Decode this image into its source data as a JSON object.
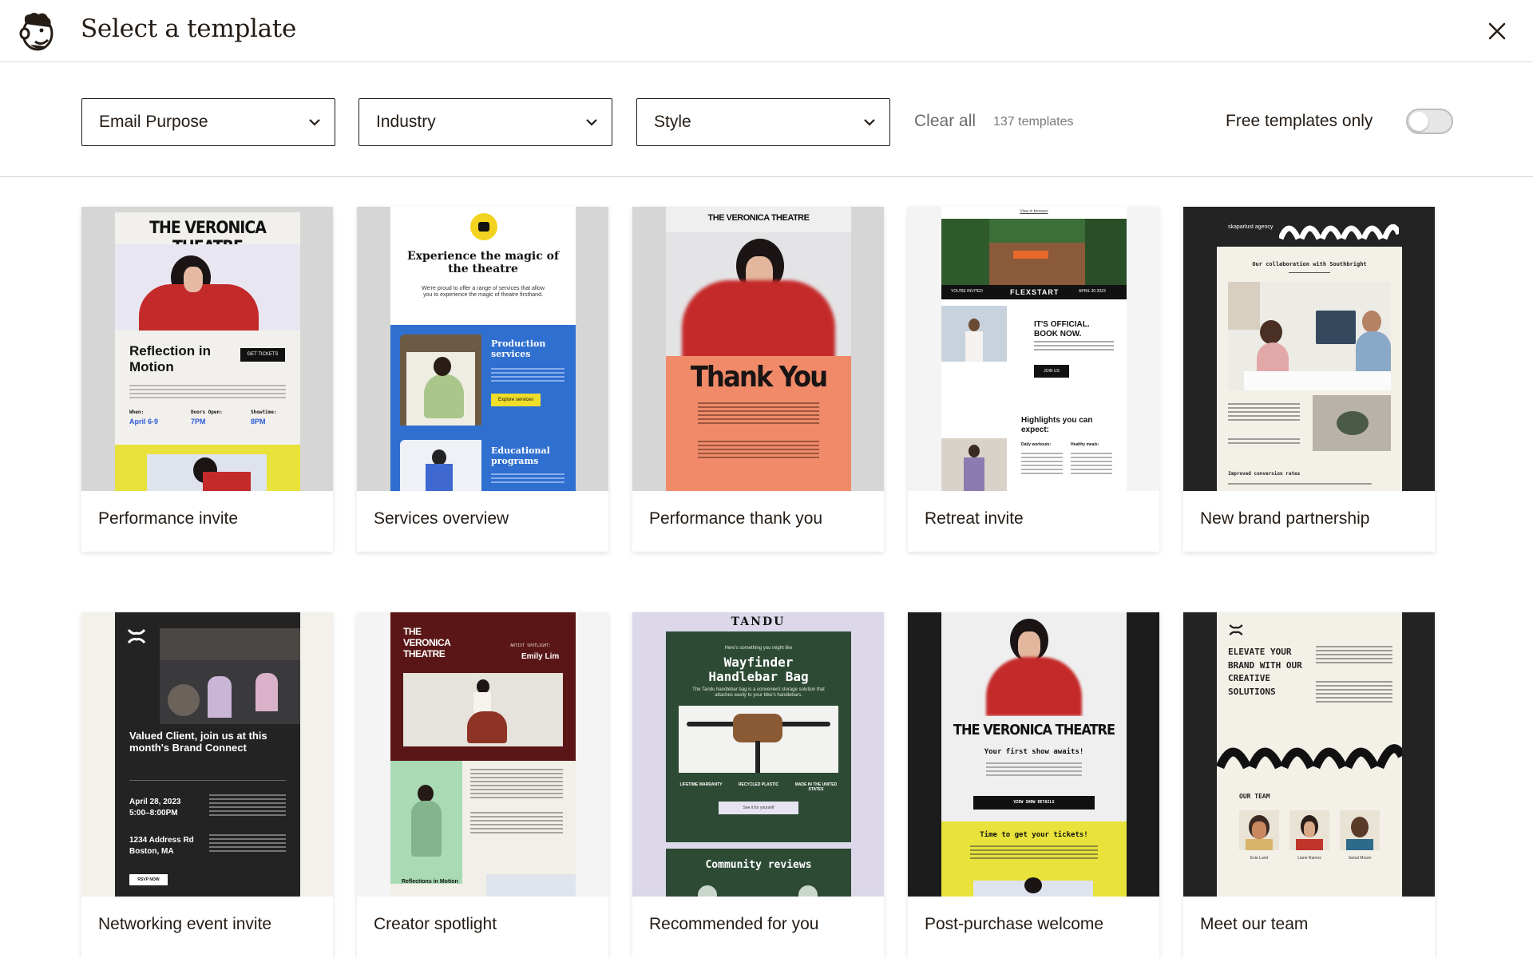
{
  "header": {
    "title": "Select a template",
    "logo_icon": "mailchimp-freddie-icon",
    "close_icon": "close-icon"
  },
  "filters": {
    "email_purpose": "Email Purpose",
    "industry": "Industry",
    "style": "Style",
    "clear_all": "Clear all",
    "count": "137 templates",
    "free_only_label": "Free templates only",
    "free_only_on": false
  },
  "templates": [
    {
      "name": "Performance invite",
      "preview": {
        "brand": "THE VERONICA THEATRE",
        "headline": "Reflection in Motion",
        "button": "GET TICKETS",
        "when_label": "When:",
        "when": "April 6-9",
        "doors_label": "Doors Open:",
        "doors": "7PM",
        "showtime_label": "Showtime:",
        "showtime": "8PM"
      }
    },
    {
      "name": "Services overview",
      "preview": {
        "headline": "Experience the magic of the theatre",
        "intro": "We're proud to offer a range of services that allow you to experience the magic of theatre firsthand.",
        "section1": "Production services",
        "button": "Explore services",
        "section2": "Educational programs"
      }
    },
    {
      "name": "Performance thank you",
      "preview": {
        "brand": "THE VERONICA THEATRE",
        "headline": "Thank You"
      }
    },
    {
      "name": "Retreat invite",
      "preview": {
        "top_link": "View in browser",
        "invited": "YOU'RE INVITED",
        "brand": "FLEXSTART",
        "date": "APRIL 30 2023",
        "headline": "IT'S OFFICIAL. BOOK NOW.",
        "button": "JOIN US",
        "highlights": "Highlights you can expect:",
        "col1": "Daily workouts:",
        "col2": "Healthy meals:"
      }
    },
    {
      "name": "New brand partnership",
      "preview": {
        "brand": "skaparlust agency",
        "headline": "Our collaboration with Southbright",
        "footer": "Improved conversion rates"
      }
    },
    {
      "name": "Networking event invite",
      "preview": {
        "headline": "Valued Client, join us at this month's Brand Connect",
        "date": "April 28, 2023",
        "time": "5:00–8:00PM",
        "address": "1234 Address Rd",
        "city": "Boston, MA",
        "button": "RSVP NOW"
      }
    },
    {
      "name": "Creator spotlight",
      "preview": {
        "brand": "THE VERONICA THEATRE",
        "kicker": "ARTIST SPOTLIGHT:",
        "artist": "Emily Lim",
        "caption": "Reflections in Motion"
      }
    },
    {
      "name": "Recommended for you",
      "preview": {
        "brand": "TANDU",
        "kicker": "Here's something you might like",
        "product": "Wayfinder Handlebar Bag",
        "description": "The Tandu handlebar bag is a convenient storage solution that attaches easily to your bike's handlebars.",
        "feature1": "LIFETIME WARRANTY",
        "feature2": "RECYCLED PLASTIC",
        "feature3": "MADE IN THE UNITED STATES",
        "button": "See it for yourself",
        "reviews": "Community reviews"
      }
    },
    {
      "name": "Post-purchase welcome",
      "preview": {
        "brand": "THE VERONICA THEATRE",
        "subhead": "Your first show awaits!",
        "button": "VIEW SHOW DETAILS",
        "cta": "Time to get your tickets!"
      }
    },
    {
      "name": "Meet our team",
      "preview": {
        "headline": "ELEVATE YOUR BRAND WITH OUR CREATIVE SOLUTIONS",
        "team": "OUR TEAM",
        "member1": "Evie Lund",
        "member2": "Liane Ramos",
        "member3": "Jamal Moore"
      }
    }
  ]
}
